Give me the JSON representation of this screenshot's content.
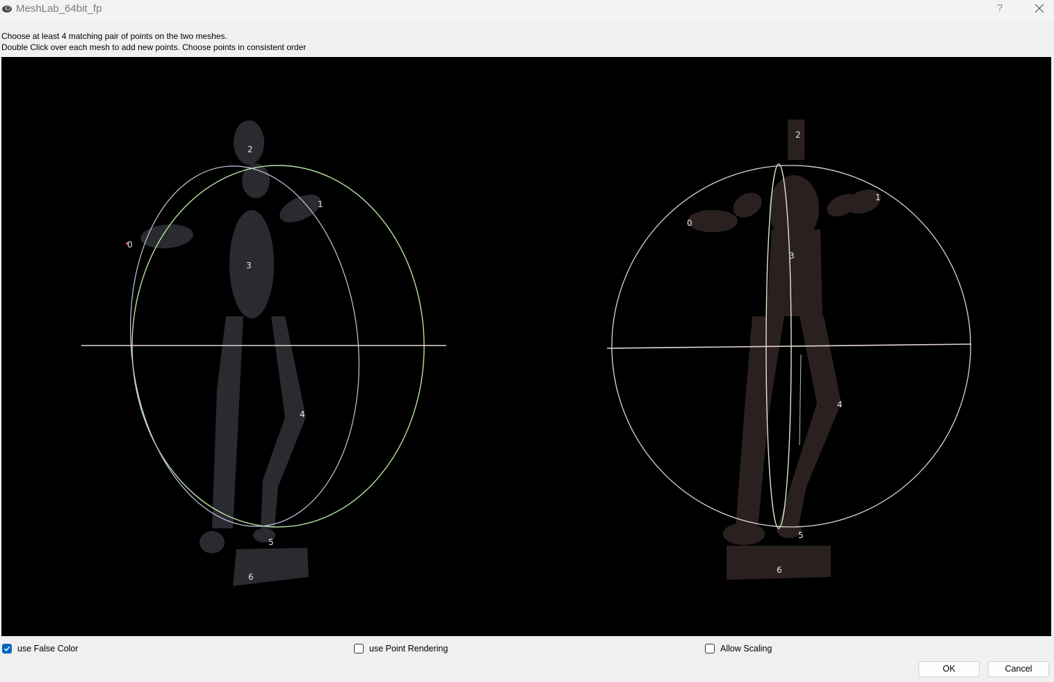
{
  "window": {
    "title": "MeshLab_64bit_fp",
    "help_label": "?"
  },
  "instructions": {
    "line1": "Choose at least 4 matching pair of points on the two meshes.",
    "line2": "Double Click over each mesh to add new points. Choose points in consistent order"
  },
  "left_mesh": {
    "point_labels": [
      "0",
      "1",
      "2",
      "3",
      "4",
      "5",
      "6"
    ]
  },
  "right_mesh": {
    "point_labels": [
      "0",
      "1",
      "2",
      "3",
      "4",
      "5",
      "6"
    ]
  },
  "options": {
    "false_color": {
      "label": "use False Color",
      "checked": true
    },
    "point_rendering": {
      "label": "use Point Rendering",
      "checked": false
    },
    "allow_scaling": {
      "label": "Allow Scaling",
      "checked": false
    }
  },
  "buttons": {
    "ok": "OK",
    "cancel": "Cancel"
  },
  "colors": {
    "viewport_bg": "#000000",
    "left_mesh": "#2a2a30",
    "right_mesh": "#2a2020",
    "checkbox_accent": "#0067c0"
  }
}
